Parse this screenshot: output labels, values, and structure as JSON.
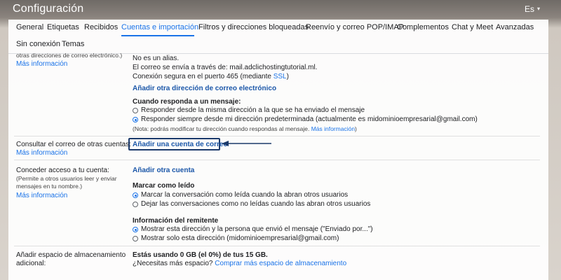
{
  "app": {
    "title": "Configuración",
    "language": "Es",
    "language_caret": "▾"
  },
  "tabs": [
    {
      "label": "General"
    },
    {
      "label": "Etiquetas"
    },
    {
      "label": "Recibidos"
    },
    {
      "label": "Cuentas e importación",
      "active": true
    },
    {
      "label": "Filtros y direcciones bloqueadas"
    },
    {
      "label": "Reenvío y correo POP/IMAP"
    },
    {
      "label": "Complementos"
    },
    {
      "label": "Chat y Meet"
    },
    {
      "label": "Avanzadas"
    },
    {
      "label": "Sin conexión"
    },
    {
      "label": "Temas"
    }
  ],
  "send_as": {
    "left_partial": "otras direcciones de correo electrónico.)",
    "more_info": "Más información",
    "not_alias": "No es un alias.",
    "sent_via": "El correo se envía a través de: mail.adclichostingtutorial.ml.",
    "secure_conn_prefix": "Conexión segura en el puerto 465 (mediante ",
    "secure_conn_link": "SSL",
    "secure_conn_suffix": ")",
    "add_address": "Añadir otra dirección de correo electrónico",
    "reply_heading": "Cuando responda a un mensaje:",
    "reply_opt_same": "Responder desde la misma dirección a la que se ha enviado el mensaje",
    "reply_opt_default": "Responder siempre desde mi dirección predeterminada (actualmente es midominioempresarial@gmail.com)",
    "reply_note": "(Nota: podrás modificar tu dirección cuando respondas al mensaje.",
    "reply_note_link": "Más información",
    "reply_note_end": ")"
  },
  "check_mail": {
    "label": "Consultar el correo de otras cuentas:",
    "more_info": "Más información",
    "add_account": "Añadir una cuenta de correo"
  },
  "grant_access": {
    "label": "Conceder acceso a tu cuenta:",
    "desc_line1": "(Permite a otros usuarios leer y enviar",
    "desc_line2": "mensajes en tu nombre.)",
    "more_info": "Más información",
    "add_account": "Añadir otra cuenta",
    "mark_read_heading": "Marcar como leído",
    "mark_read_opt1": "Marcar la conversación como leída cuando la abran otros usuarios",
    "mark_read_opt2": "Dejar las conversaciones como no leídas cuando las abran otros usuarios",
    "sender_info_heading": "Información del remitente",
    "sender_opt1": "Mostrar esta dirección y la persona que envió el mensaje (\"Enviado por...\")",
    "sender_opt2": "Mostrar solo esta dirección (midominioempresarial@gmail.com)"
  },
  "storage": {
    "label_line1": "Añadir espacio de almacenamiento",
    "label_line2": "adicional:",
    "usage": "Estás usando 0 GB (el 0%) de tus 15 GB.",
    "need_more": "¿Necesitas más espacio?",
    "buy_link": "Comprar más espacio de almacenamiento"
  },
  "colors": {
    "accent": "#1a73e8",
    "highlight_box": "#1b3a6b"
  }
}
